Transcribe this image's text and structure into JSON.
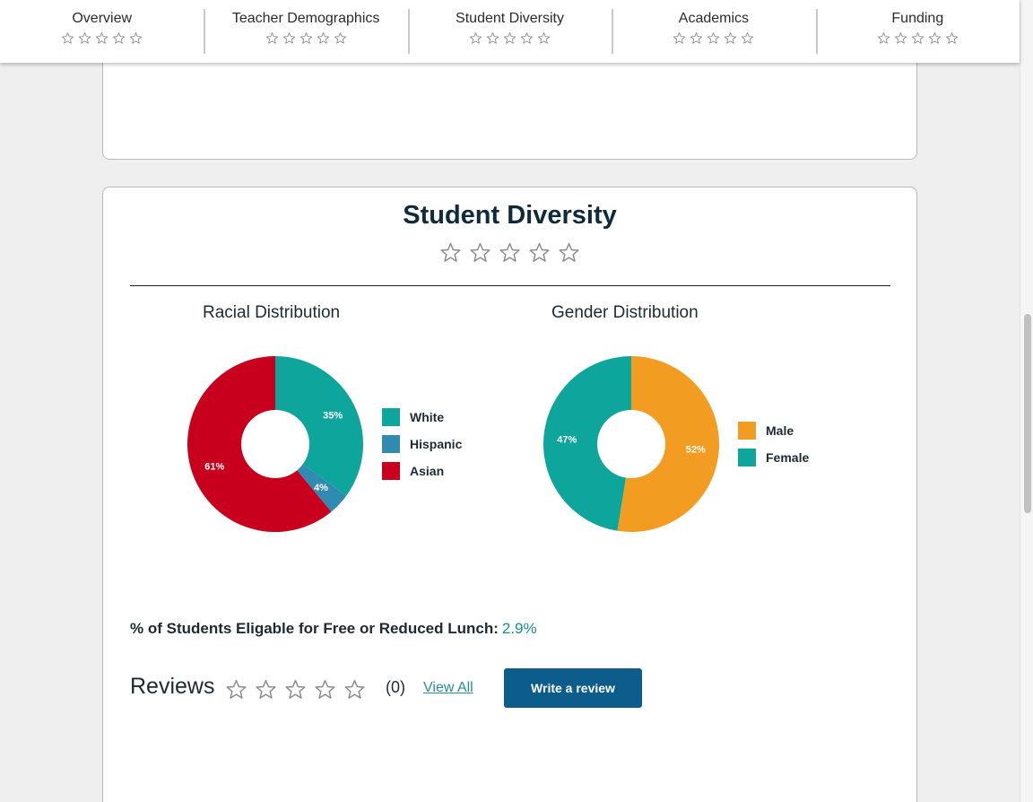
{
  "nav": {
    "items": [
      {
        "label": "Overview",
        "rating": 0
      },
      {
        "label": "Teacher Demographics",
        "rating": 0
      },
      {
        "label": "Student Diversity",
        "rating": 0
      },
      {
        "label": "Academics",
        "rating": 0
      },
      {
        "label": "Funding",
        "rating": 0
      }
    ]
  },
  "section": {
    "title": "Student Diversity",
    "rating": 0
  },
  "racial": {
    "title": "Racial Distribution"
  },
  "gender": {
    "title": "Gender Distribution"
  },
  "chart_data": [
    {
      "type": "pie",
      "title": "Racial Distribution",
      "categories": [
        "White",
        "Hispanic",
        "Asian"
      ],
      "values": [
        35,
        4,
        61
      ],
      "labels": [
        "35%",
        "4%",
        "61%"
      ],
      "colors": [
        "#0ea69c",
        "#2f8bb0",
        "#c9001d"
      ],
      "legend": "right"
    },
    {
      "type": "pie",
      "title": "Gender Distribution",
      "categories": [
        "Male",
        "Female"
      ],
      "values": [
        52,
        47
      ],
      "labels": [
        "52%",
        "47%"
      ],
      "colors": [
        "#f39c22",
        "#0ea69c"
      ],
      "legend": "right"
    }
  ],
  "lunch": {
    "label": "% of Students Eligable for Free or Reduced Lunch:",
    "value": "2.9%"
  },
  "reviews": {
    "label": "Reviews",
    "rating": 0,
    "count": "(0)",
    "view_all": "View All",
    "write_button": "Write a review"
  },
  "icons": {
    "star": "star-outline-icon"
  }
}
